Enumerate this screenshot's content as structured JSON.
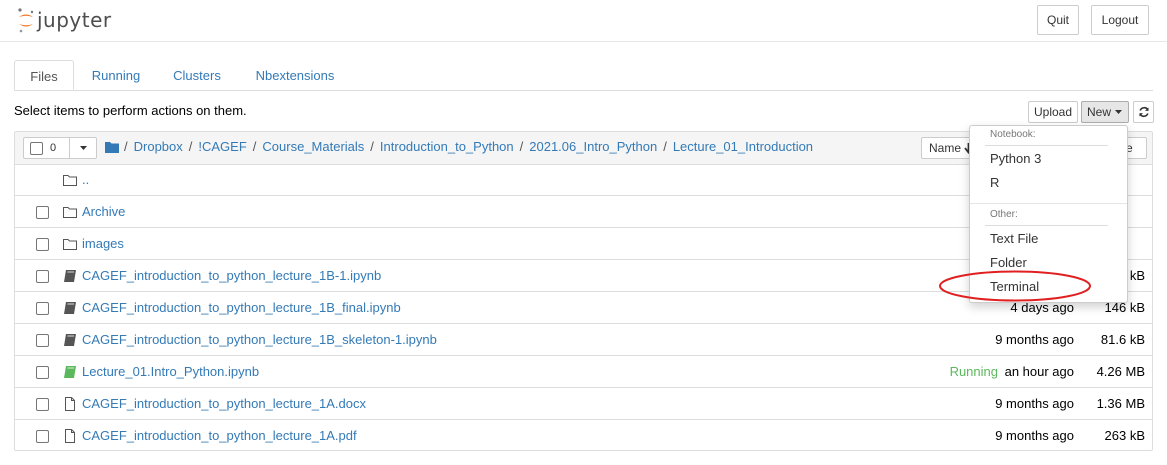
{
  "header": {
    "logo_text": "jupyter",
    "quit_label": "Quit",
    "logout_label": "Logout"
  },
  "tabs": [
    {
      "label": "Files",
      "active": true
    },
    {
      "label": "Running",
      "active": false
    },
    {
      "label": "Clusters",
      "active": false
    },
    {
      "label": "Nbextensions",
      "active": false
    }
  ],
  "toolbar": {
    "select_message": "Select items to perform actions on them.",
    "upload_label": "Upload",
    "new_label": "New",
    "selected_count": "0"
  },
  "breadcrumb": [
    "Dropbox",
    "!CAGEF",
    "Course_Materials",
    "Introduction_to_Python",
    "2021.06_Intro_Python",
    "Lecture_01_Introduction"
  ],
  "list_header": {
    "name_sort_label": "Name",
    "size_sort_stub": "e"
  },
  "files": [
    {
      "name": "..",
      "type": "parent"
    },
    {
      "name": "Archive",
      "type": "folder"
    },
    {
      "name": "images",
      "type": "folder"
    },
    {
      "name": "CAGEF_introduction_to_python_lecture_1B-1.ipynb",
      "type": "notebook",
      "size": "kB"
    },
    {
      "name": "CAGEF_introduction_to_python_lecture_1B_final.ipynb",
      "type": "notebook",
      "modified": "4 days ago",
      "size": "146 kB"
    },
    {
      "name": "CAGEF_introduction_to_python_lecture_1B_skeleton-1.ipynb",
      "type": "notebook",
      "modified": "9 months ago",
      "size": "81.6 kB"
    },
    {
      "name": "Lecture_01.Intro_Python.ipynb",
      "type": "notebook-running",
      "status": "Running",
      "modified": "an hour ago",
      "size": "4.26 MB"
    },
    {
      "name": "CAGEF_introduction_to_python_lecture_1A.docx",
      "type": "file",
      "modified": "9 months ago",
      "size": "1.36 MB"
    },
    {
      "name": "CAGEF_introduction_to_python_lecture_1A.pdf",
      "type": "file",
      "modified": "9 months ago",
      "size": "263 kB"
    }
  ],
  "new_menu": {
    "notebook_header": "Notebook:",
    "notebook_items": [
      "Python 3",
      "R"
    ],
    "other_header": "Other:",
    "other_items": [
      "Text File",
      "Folder",
      "Terminal"
    ]
  },
  "colors": {
    "link": "#337ab7",
    "running": "#5cb85c",
    "annotation": "#e02020",
    "logo_orange": "#f37726"
  }
}
